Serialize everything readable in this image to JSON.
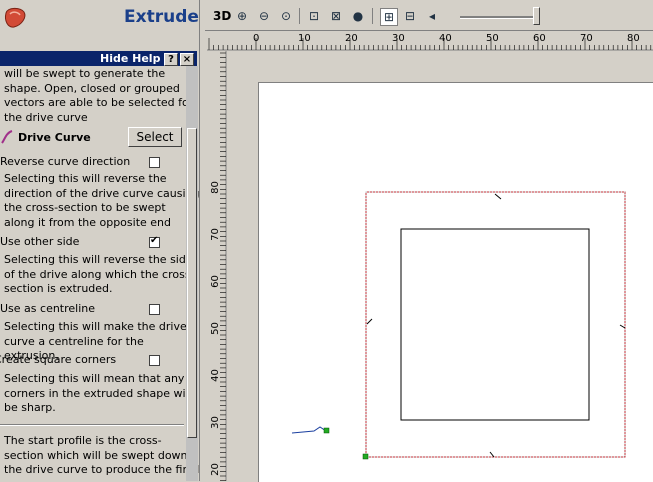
{
  "panel": {
    "title": "Extrude",
    "help_title": "Hide Help",
    "help_btn": "?",
    "close_btn": "×",
    "intro": [
      "will be swept to generate the",
      "shape. Open, closed or grouped",
      "vectors are able to be selected for",
      "the drive curve"
    ],
    "drive_curve_label": "Drive Curve",
    "select_label": "Select",
    "options": [
      {
        "label": "Reverse curve direction",
        "checked": false,
        "desc": [
          "Selecting this will reverse the",
          "direction of the drive curve causing",
          "the cross-section to be swept",
          "along it from the opposite end"
        ]
      },
      {
        "label": "Use other side",
        "checked": true,
        "desc": [
          "Selecting this will reverse the side",
          "of the drive along which the cross-",
          "section is extruded."
        ]
      },
      {
        "label": "Use as centreline",
        "checked": false,
        "desc": [
          "Selecting this will make the drive",
          "curve a centreline for the extrusion."
        ]
      },
      {
        "label": "Create square corners",
        "checked": false,
        "desc": [
          "Selecting this will mean that any",
          "corners in the extruded shape will",
          "be sharp."
        ]
      }
    ],
    "footer": [
      "The start profile is the cross-",
      "section which will be swept down",
      "the drive curve to produce the final"
    ]
  },
  "toolbar": {
    "label_3d": "3D",
    "tools": [
      "zoom-in-icon",
      "zoom-out-icon",
      "zoom-fit-icon",
      "zoom-selection-icon",
      "zoom-page-icon",
      "zoom-previous-icon",
      "view-mode-1-icon",
      "view-mode-2-icon",
      "back-icon"
    ],
    "slider_value": 0.95
  },
  "ruler": {
    "top": [
      "0",
      "10",
      "20",
      "30",
      "40",
      "50",
      "60",
      "70",
      "80"
    ],
    "left": [
      "80",
      "70",
      "60",
      "50",
      "40",
      "30",
      "20"
    ]
  },
  "colors": {
    "accent": "#0a246a",
    "title": "#1a3f8a",
    "selection": "#c0303a",
    "handle": "#22aa22"
  }
}
